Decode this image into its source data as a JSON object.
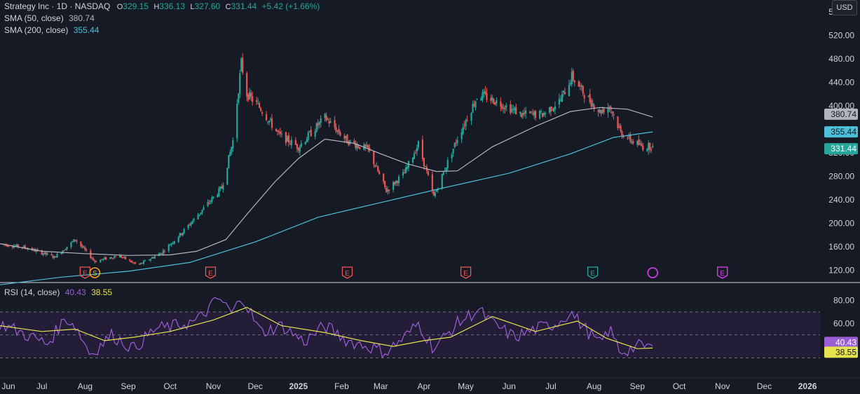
{
  "legend": {
    "symbol": "Strategy Inc · 1D · NASDAQ",
    "o_label": "O",
    "o_value": "329.15",
    "h_label": "H",
    "h_value": "336.13",
    "l_label": "L",
    "l_value": "327.60",
    "c_label": "C",
    "c_value": "331.44",
    "change": "+5.42 (+1.66%)",
    "sma50_label": "SMA (50, close)",
    "sma50_value": "380.74",
    "sma200_label": "SMA (200, close)",
    "sma200_value": "355.44",
    "rsi_label": "RSI (14, close)",
    "rsi_value": "40.43",
    "rsi_ma_value": "38.55"
  },
  "currency_button": "USD",
  "colors": {
    "background": "#161a25",
    "up": "#26a69a",
    "down": "#ef5350",
    "sma50": "#b2b5be",
    "sma200": "#4dbfd9",
    "rsi": "#9c5ed6",
    "rsi_ma": "#e5e34d",
    "rsi_band": "#231d38",
    "earnings": "#ef5350",
    "earnings_future": "#26a69a",
    "dividend": "#e040fb"
  },
  "chart_data": [
    {
      "type": "candlestick",
      "title": "Strategy Inc · 1D · NASDAQ",
      "ylim": [
        100,
        580
      ],
      "y_ticks": [
        "120.00",
        "160.00",
        "200.00",
        "240.00",
        "280.00",
        "320.00",
        "360.00",
        "400.00",
        "440.00",
        "480.00",
        "520.00",
        "560.00"
      ],
      "y_tick_values": [
        120,
        160,
        200,
        240,
        280,
        320,
        360,
        400,
        440,
        480,
        520,
        560
      ],
      "x_ticks": [
        "Jun",
        "Jul",
        "Aug",
        "Sep",
        "Oct",
        "Nov",
        "Dec",
        "2025",
        "Feb",
        "Mar",
        "Apr",
        "May",
        "Jun",
        "Jul",
        "Aug",
        "Sep",
        "Oct",
        "Nov",
        "Dec",
        "2026"
      ],
      "x_tick_months": [
        "2024-06",
        "2024-07",
        "2024-08",
        "2024-09",
        "2024-10",
        "2024-11",
        "2024-12",
        "2025-01",
        "2025-02",
        "2025-03",
        "2025-04",
        "2025-05",
        "2025-06",
        "2025-07",
        "2025-08",
        "2025-09",
        "2025-10",
        "2025-11",
        "2025-12",
        "2026-01"
      ],
      "x_range": [
        "2024-06-01",
        "2026-01-10"
      ],
      "price_path": [
        [
          "2024-06-01",
          165
        ],
        [
          "2024-06-20",
          158
        ],
        [
          "2024-07-10",
          142
        ],
        [
          "2024-07-25",
          172
        ],
        [
          "2024-08-08",
          135
        ],
        [
          "2024-08-25",
          145
        ],
        [
          "2024-09-08",
          128
        ],
        [
          "2024-09-25",
          150
        ],
        [
          "2024-10-10",
          185
        ],
        [
          "2024-10-25",
          225
        ],
        [
          "2024-11-07",
          260
        ],
        [
          "2024-11-15",
          340
        ],
        [
          "2024-11-21",
          473
        ],
        [
          "2024-11-25",
          420
        ],
        [
          "2024-12-05",
          395
        ],
        [
          "2024-12-18",
          350
        ],
        [
          "2025-01-01",
          330
        ],
        [
          "2025-01-20",
          380
        ],
        [
          "2025-02-05",
          340
        ],
        [
          "2025-02-20",
          325
        ],
        [
          "2025-03-05",
          255
        ],
        [
          "2025-03-18",
          285
        ],
        [
          "2025-03-28",
          335
        ],
        [
          "2025-04-08",
          245
        ],
        [
          "2025-04-25",
          345
        ],
        [
          "2025-05-10",
          420
        ],
        [
          "2025-05-25",
          405
        ],
        [
          "2025-06-10",
          385
        ],
        [
          "2025-06-25",
          385
        ],
        [
          "2025-07-08",
          410
        ],
        [
          "2025-07-16",
          450
        ],
        [
          "2025-07-25",
          420
        ],
        [
          "2025-08-05",
          390
        ],
        [
          "2025-08-12",
          400
        ],
        [
          "2025-08-20",
          355
        ],
        [
          "2025-08-28",
          340
        ],
        [
          "2025-09-05",
          330
        ],
        [
          "2025-09-12",
          331.44
        ]
      ],
      "last_candle": {
        "date": "2025-09-12",
        "open": 329.15,
        "high": 336.13,
        "low": 327.6,
        "close": 331.44
      },
      "sma50": [
        [
          "2024-06-01",
          165
        ],
        [
          "2024-07-01",
          152
        ],
        [
          "2024-08-01",
          148
        ],
        [
          "2024-09-01",
          145
        ],
        [
          "2024-10-01",
          146
        ],
        [
          "2024-10-20",
          152
        ],
        [
          "2024-11-10",
          172
        ],
        [
          "2024-11-25",
          215
        ],
        [
          "2024-12-15",
          270
        ],
        [
          "2025-01-01",
          310
        ],
        [
          "2025-01-20",
          343
        ],
        [
          "2025-02-10",
          336
        ],
        [
          "2025-03-01",
          318
        ],
        [
          "2025-03-20",
          301
        ],
        [
          "2025-04-10",
          288
        ],
        [
          "2025-04-25",
          289
        ],
        [
          "2025-05-20",
          330
        ],
        [
          "2025-06-20",
          365
        ],
        [
          "2025-07-15",
          390
        ],
        [
          "2025-08-05",
          397
        ],
        [
          "2025-08-25",
          394
        ],
        [
          "2025-09-12",
          380.74
        ]
      ],
      "sma200": [
        [
          "2024-06-01",
          95
        ],
        [
          "2024-07-15",
          108
        ],
        [
          "2024-09-01",
          118
        ],
        [
          "2024-10-15",
          133
        ],
        [
          "2024-12-01",
          168
        ],
        [
          "2025-01-15",
          210
        ],
        [
          "2025-03-01",
          235
        ],
        [
          "2025-04-15",
          260
        ],
        [
          "2025-06-01",
          285
        ],
        [
          "2025-07-15",
          318
        ],
        [
          "2025-08-15",
          346
        ],
        [
          "2025-09-12",
          355.44
        ]
      ],
      "price_labels": [
        "380.74",
        "355.44",
        "331.44"
      ],
      "events": [
        {
          "date": "2024-08-01",
          "label": "E",
          "kind": "earnings"
        },
        {
          "date": "2024-08-08",
          "label": "S",
          "kind": "split"
        },
        {
          "date": "2024-10-30",
          "label": "E",
          "kind": "earnings"
        },
        {
          "date": "2025-02-05",
          "label": "E",
          "kind": "earnings"
        },
        {
          "date": "2025-05-01",
          "label": "E",
          "kind": "earnings"
        },
        {
          "date": "2025-07-31",
          "label": "E",
          "kind": "earnings_future"
        },
        {
          "date": "2025-09-12",
          "label": "",
          "kind": "dividend"
        },
        {
          "date": "2025-11-01",
          "label": "E",
          "kind": "earnings_next"
        }
      ]
    },
    {
      "type": "line",
      "title": "RSI (14, close)",
      "ylim": [
        15,
        95
      ],
      "y_ticks": [
        "40.00",
        "60.00",
        "80.00"
      ],
      "y_tick_values": [
        40,
        60,
        80
      ],
      "band": [
        30,
        70
      ],
      "series": [
        {
          "name": "RSI",
          "values_path": [
            [
              "2024-06-01",
              60
            ],
            [
              "2024-06-20",
              50
            ],
            [
              "2024-07-05",
              42
            ],
            [
              "2024-07-18",
              65
            ],
            [
              "2024-07-25",
              58
            ],
            [
              "2024-08-05",
              33
            ],
            [
              "2024-08-20",
              50
            ],
            [
              "2024-09-05",
              38
            ],
            [
              "2024-09-20",
              55
            ],
            [
              "2024-10-05",
              58
            ],
            [
              "2024-10-20",
              62
            ],
            [
              "2024-11-05",
              82
            ],
            [
              "2024-11-15",
              68
            ],
            [
              "2024-11-21",
              85
            ],
            [
              "2024-12-05",
              52
            ],
            [
              "2024-12-20",
              58
            ],
            [
              "2025-01-05",
              44
            ],
            [
              "2025-01-20",
              58
            ],
            [
              "2025-02-05",
              45
            ],
            [
              "2025-02-20",
              40
            ],
            [
              "2025-03-05",
              35
            ],
            [
              "2025-03-20",
              50
            ],
            [
              "2025-03-28",
              60
            ],
            [
              "2025-04-08",
              38
            ],
            [
              "2025-04-25",
              60
            ],
            [
              "2025-05-10",
              72
            ],
            [
              "2025-05-20",
              60
            ],
            [
              "2025-06-05",
              48
            ],
            [
              "2025-06-20",
              55
            ],
            [
              "2025-07-05",
              60
            ],
            [
              "2025-07-15",
              70
            ],
            [
              "2025-07-28",
              52
            ],
            [
              "2025-08-05",
              42
            ],
            [
              "2025-08-12",
              55
            ],
            [
              "2025-08-20",
              35
            ],
            [
              "2025-09-01",
              40
            ],
            [
              "2025-09-12",
              40.43
            ]
          ]
        },
        {
          "name": "RSI MA",
          "values_path": [
            [
              "2024-06-01",
              58
            ],
            [
              "2024-07-01",
              53
            ],
            [
              "2024-07-25",
              55
            ],
            [
              "2024-08-15",
              45
            ],
            [
              "2024-09-05",
              48
            ],
            [
              "2024-10-01",
              53
            ],
            [
              "2024-11-01",
              63
            ],
            [
              "2024-11-25",
              74
            ],
            [
              "2024-12-20",
              58
            ],
            [
              "2025-01-20",
              52
            ],
            [
              "2025-02-15",
              45
            ],
            [
              "2025-03-10",
              40
            ],
            [
              "2025-04-01",
              45
            ],
            [
              "2025-04-20",
              48
            ],
            [
              "2025-05-20",
              66
            ],
            [
              "2025-06-20",
              53
            ],
            [
              "2025-07-20",
              62
            ],
            [
              "2025-08-10",
              47
            ],
            [
              "2025-09-01",
              38
            ],
            [
              "2025-09-12",
              38.55
            ]
          ]
        }
      ],
      "value_labels": [
        "40.43",
        "38.55"
      ]
    }
  ]
}
